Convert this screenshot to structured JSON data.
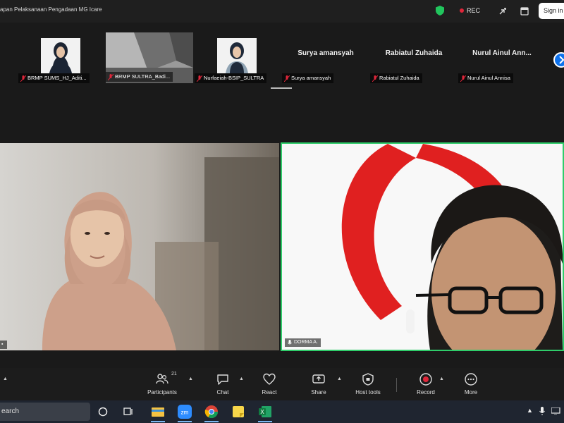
{
  "window": {
    "title": "apan Pelaksanaan Pengadaan MG Icare",
    "rec_label": "REC",
    "signin_label": "Sign in"
  },
  "gallery": [
    {
      "label": "BRMP SUMS_HJ_Aditi...",
      "type": "avatar"
    },
    {
      "label": "BRMP SULTRA_Badi...",
      "type": "video"
    },
    {
      "label": "Nurfaeiah-BSIP_SULTRA",
      "type": "avatar"
    },
    {
      "big_name": "Surya amansyah",
      "label": "Surya amansyah",
      "type": "name"
    },
    {
      "big_name": "Rabiatul Zuhaida",
      "label": "Rabiatul Zuhaida",
      "type": "name"
    },
    {
      "big_name": "Nurul Ainul Ann...",
      "label": "Nurul Ainul Annisa",
      "type": "name"
    }
  ],
  "main_videos": {
    "right_label": "DORMA A."
  },
  "toolbar": {
    "participants_count": "21",
    "items": [
      {
        "label": "Participants",
        "icon": "participants-icon"
      },
      {
        "label": "Chat",
        "icon": "chat-icon"
      },
      {
        "label": "React",
        "icon": "react-icon"
      },
      {
        "label": "Share",
        "icon": "share-icon"
      },
      {
        "label": "Host tools",
        "icon": "host-tools-icon"
      },
      {
        "label": "Record",
        "icon": "record-icon"
      },
      {
        "label": "More",
        "icon": "more-icon"
      }
    ]
  },
  "taskbar": {
    "search_text": "earch",
    "apps": [
      "task-view-icon",
      "file-explorer-icon",
      "zoom-icon",
      "chrome-icon",
      "sticky-notes-icon",
      "excel-icon"
    ]
  },
  "colors": {
    "active_speaker": "#2fcc6a",
    "record_red": "#e0263a",
    "zoom_blue": "#0e72ed"
  }
}
